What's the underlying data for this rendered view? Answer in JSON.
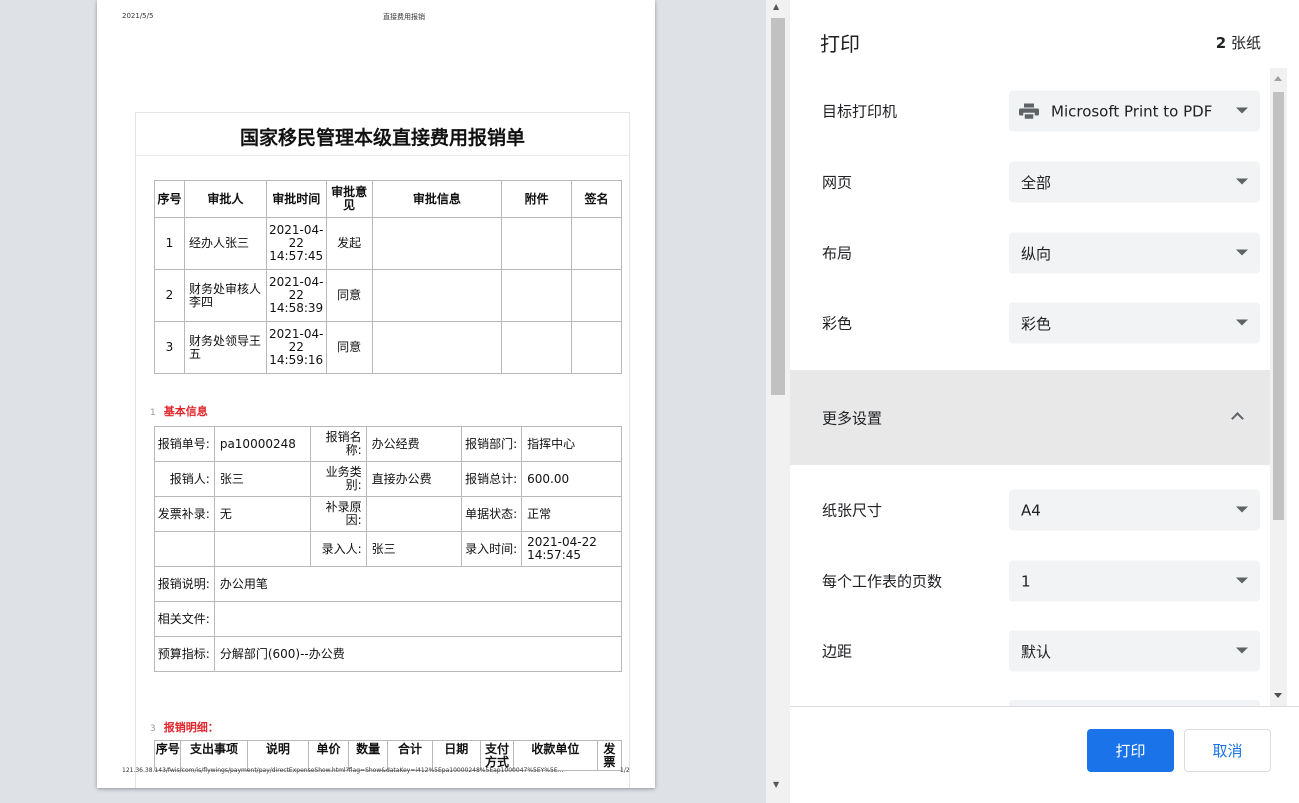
{
  "preview": {
    "header_date": "2021/5/5",
    "header_title": "直接费用报销",
    "footer_url": "121.36.38.143/fwis/com/is/flywings/payment/pay/directExpenseShow.html?flag=Show&dataKey=i412%5Epa10000248%5Eap1000047%5EY%5E...",
    "footer_page": "1/2",
    "doc_title": "国家移民管理本级直接费用报销单",
    "approval": {
      "headers": [
        "序号",
        "审批人",
        "审批时间",
        "审批意见",
        "审批信息",
        "附件",
        "签名"
      ],
      "rows": [
        {
          "no": "1",
          "approver": "经办人张三",
          "time": "2021-04-22 14:57:45",
          "opinion": "发起"
        },
        {
          "no": "2",
          "approver": "财务处审核人李四",
          "time": "2021-04-22 14:58:39",
          "opinion": "同意"
        },
        {
          "no": "3",
          "approver": "财务处领导王五",
          "time": "2021-04-22 14:59:16",
          "opinion": "同意"
        }
      ]
    },
    "basic": {
      "num": "1",
      "title": "基本信息",
      "bill_no_label": "报销单号:",
      "bill_no": "pa10000248",
      "name_label": "报销名称:",
      "name": "办公经费",
      "dept_label": "报销部门:",
      "dept": "指挥中心",
      "person_label": "报销人:",
      "person": "张三",
      "biz_label": "业务类别:",
      "biz": "直接办公费",
      "total_label": "报销总计:",
      "total": "600.00",
      "invoice_label": "发票补录:",
      "invoice": "无",
      "reason_label": "补录原因:",
      "reason": "",
      "state_label": "单据状态:",
      "state": "正常",
      "entry_label": "录入人:",
      "entry": "张三",
      "entry_time_label": "录入时间:",
      "entry_time": "2021-04-22 14:57:45",
      "desc_label": "报销说明:",
      "desc": "办公用笔",
      "files_label": "相关文件:",
      "files": "",
      "budget_label": "预算指标:",
      "budget": "分解部门(600)--办公费"
    },
    "detail": {
      "num": "3",
      "title": "报销明细：",
      "headers": [
        "序号",
        "支出事项",
        "说明",
        "单价",
        "数量",
        "合计",
        "日期",
        "支付方式",
        "收款单位",
        "发票"
      ]
    }
  },
  "sidebar": {
    "title": "打印",
    "sheets_count": "2",
    "sheets_unit": " 张纸",
    "printer_label": "目标打印机",
    "printer_value": "Microsoft Print to PDF",
    "pages_label": "网页",
    "pages_value": "全部",
    "layout_label": "布局",
    "layout_value": "纵向",
    "color_label": "彩色",
    "color_value": "彩色",
    "more_label": "更多设置",
    "paper_label": "纸张尺寸",
    "paper_value": "A4",
    "per_sheet_label": "每个工作表的页数",
    "per_sheet_value": "1",
    "margin_label": "边距",
    "margin_value": "默认",
    "print_button": "打印",
    "cancel_button": "取消"
  },
  "colors": {
    "primary": "#1a73e8",
    "section_red": "#e0252b"
  }
}
